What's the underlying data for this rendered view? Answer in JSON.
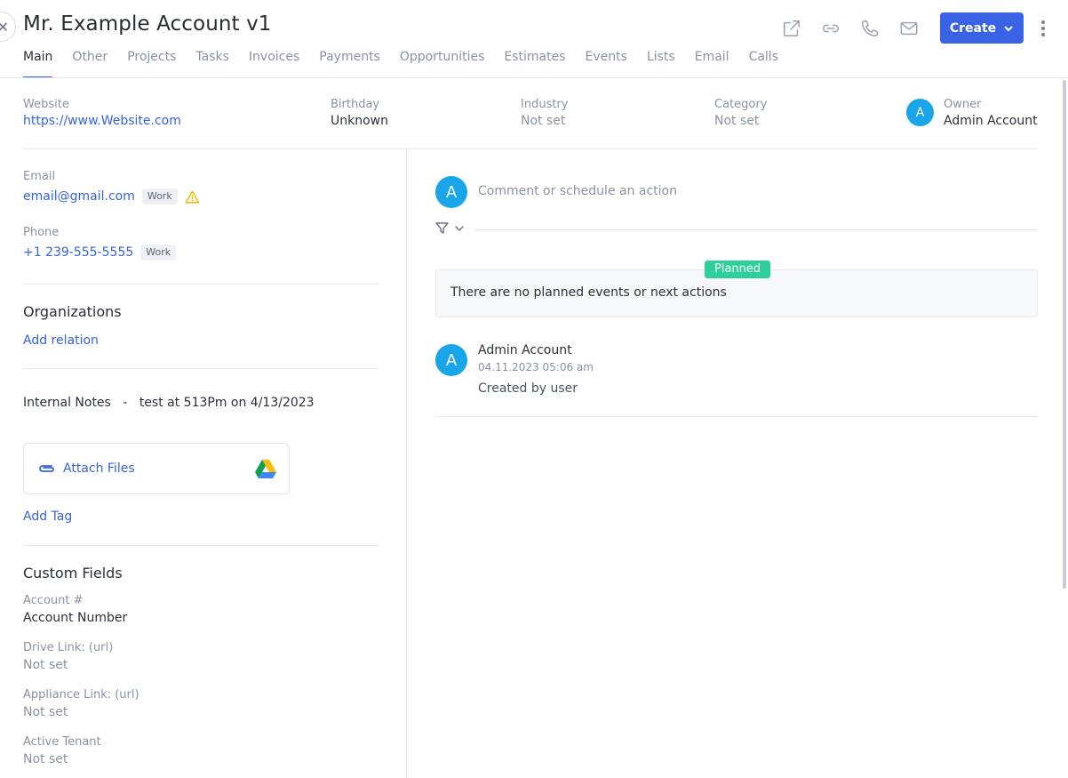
{
  "header": {
    "title": "Mr. Example Account v1",
    "create_label": "Create",
    "icons": [
      "close-icon",
      "external-link-icon",
      "link-icon",
      "phone-icon",
      "mail-icon",
      "chevron-down-icon",
      "more-vertical-icon"
    ]
  },
  "tabs": [
    "Main",
    "Other",
    "Projects",
    "Tasks",
    "Invoices",
    "Payments",
    "Opportunities",
    "Estimates",
    "Events",
    "Lists",
    "Email",
    "Calls"
  ],
  "summary": {
    "website": {
      "label": "Website",
      "value": "https://www.Website.com"
    },
    "birthday": {
      "label": "Birthday",
      "value": "Unknown"
    },
    "industry": {
      "label": "Industry",
      "value": "Not set"
    },
    "category": {
      "label": "Category",
      "value": "Not set"
    },
    "owner": {
      "label": "Owner",
      "value": "Admin Account",
      "avatar": "A"
    }
  },
  "contact": {
    "email": {
      "label": "Email",
      "value": "email@gmail.com",
      "badge": "Work"
    },
    "phone": {
      "label": "Phone",
      "value": "+1 239-555-5555",
      "badge": "Work"
    }
  },
  "organizations": {
    "title": "Organizations",
    "add_label": "Add relation"
  },
  "notes": {
    "label": "Internal Notes",
    "separator": "-",
    "text": "test at 513Pm on 4/13/2023"
  },
  "attach": {
    "label": "Attach Files"
  },
  "tag": {
    "add_label": "Add Tag"
  },
  "custom_fields": {
    "title": "Custom Fields",
    "items": [
      {
        "label": "Account #",
        "value": "Account Number"
      },
      {
        "label": "Drive Link: (url)",
        "value": "Not set"
      },
      {
        "label": "Appliance Link: (url)",
        "value": "Not set"
      },
      {
        "label": "Active Tenant",
        "value": "Not set"
      }
    ]
  },
  "activity": {
    "avatar": "A",
    "comment_placeholder": "Comment or schedule an action",
    "planned_badge": "Planned",
    "planned_empty": "There are no planned events or next actions",
    "feed": [
      {
        "avatar": "A",
        "name": "Admin Account",
        "time": "04.11.2023 05:06 am",
        "text": "Created by user"
      }
    ]
  },
  "colors": {
    "accent": "#3a62e4",
    "link": "#3562e0",
    "avatar": "#1aa5e8",
    "planned": "#2fcf9c",
    "warning": "#f4b400"
  }
}
